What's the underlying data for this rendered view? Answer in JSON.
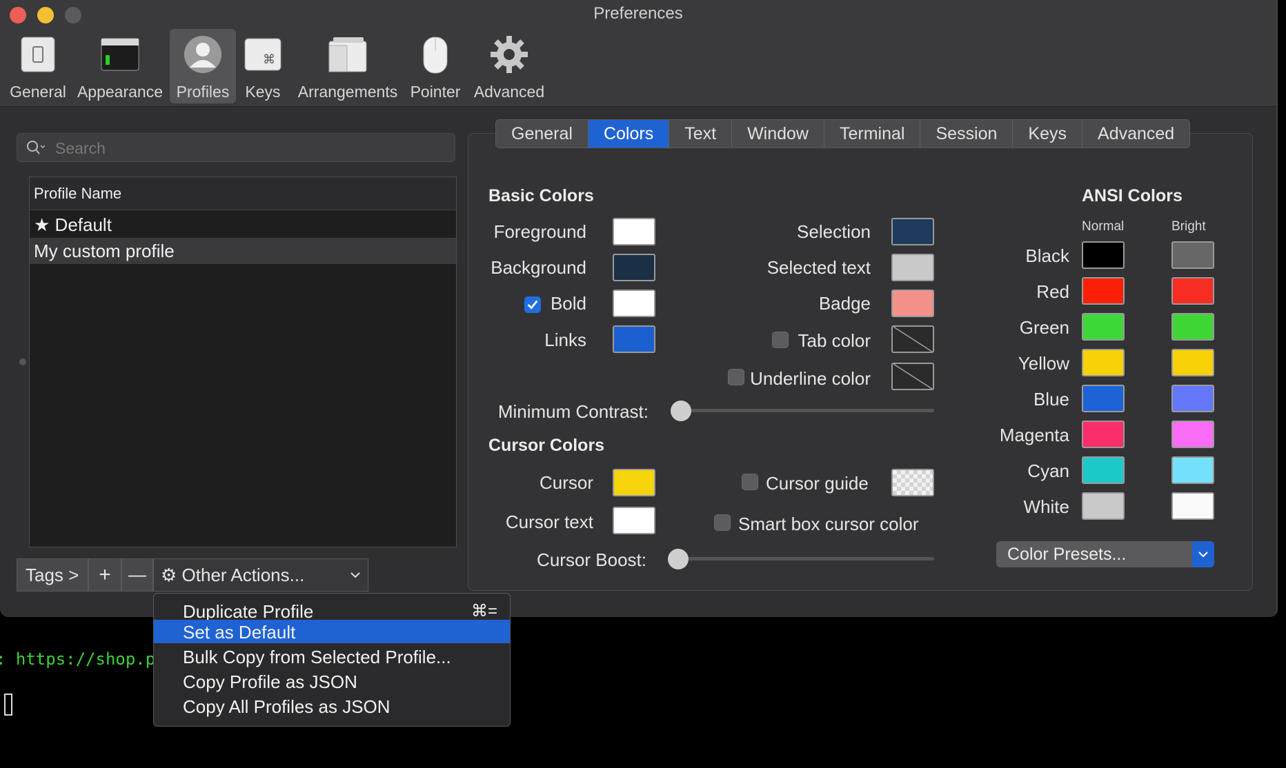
{
  "window": {
    "title": "Preferences"
  },
  "toolbar": [
    {
      "label": "General",
      "icon": "general-icon"
    },
    {
      "label": "Appearance",
      "icon": "appearance-icon"
    },
    {
      "label": "Profiles",
      "icon": "profiles-icon",
      "selected": true
    },
    {
      "label": "Keys",
      "icon": "keys-icon"
    },
    {
      "label": "Arrangements",
      "icon": "arrangements-icon"
    },
    {
      "label": "Pointer",
      "icon": "pointer-icon"
    },
    {
      "label": "Advanced",
      "icon": "gear-icon"
    }
  ],
  "search": {
    "placeholder": "Search"
  },
  "profiles": {
    "header": "Profile Name",
    "rows": [
      {
        "label": "Default",
        "star": true
      },
      {
        "label": "My custom profile",
        "selected": true
      }
    ]
  },
  "bottom_bar": {
    "tags": "Tags >",
    "add": "+",
    "remove": "—",
    "other_actions": "Other Actions..."
  },
  "tabs": [
    {
      "label": "General"
    },
    {
      "label": "Colors",
      "active": true
    },
    {
      "label": "Text"
    },
    {
      "label": "Window"
    },
    {
      "label": "Terminal"
    },
    {
      "label": "Session"
    },
    {
      "label": "Keys"
    },
    {
      "label": "Advanced"
    }
  ],
  "basic": {
    "title": "Basic Colors",
    "foreground": {
      "label": "Foreground",
      "color": "#ffffff"
    },
    "background": {
      "label": "Background",
      "color": "#1b2f45"
    },
    "bold": {
      "label": "Bold",
      "color": "#ffffff",
      "checked": true
    },
    "links": {
      "label": "Links",
      "color": "#1c5fcf"
    },
    "selection": {
      "label": "Selection",
      "color": "#1e3a5c"
    },
    "selected_text": {
      "label": "Selected text",
      "color": "#c9c9c9"
    },
    "badge": {
      "label": "Badge",
      "color": "#f3918a"
    },
    "tab_color": {
      "label": "Tab color",
      "checked": false
    },
    "underline_color": {
      "label": "Underline color",
      "checked": false
    },
    "min_contrast": {
      "label": "Minimum Contrast:",
      "value": 0
    }
  },
  "cursor": {
    "title": "Cursor Colors",
    "cursor": {
      "label": "Cursor",
      "color": "#f6d40c"
    },
    "cursor_text": {
      "label": "Cursor text",
      "color": "#ffffff"
    },
    "cursor_guide": {
      "label": "Cursor guide",
      "checked": false
    },
    "smart_box": {
      "label": "Smart box cursor color",
      "checked": false
    },
    "boost": {
      "label": "Cursor Boost:",
      "value": 0
    }
  },
  "ansi": {
    "title": "ANSI Colors",
    "normal_label": "Normal",
    "bright_label": "Bright",
    "rows": [
      {
        "label": "Black",
        "normal": "#000000",
        "bright": "#676767"
      },
      {
        "label": "Red",
        "normal": "#fb1f08",
        "bright": "#f72c23"
      },
      {
        "label": "Green",
        "normal": "#3fd83a",
        "bright": "#3ed635"
      },
      {
        "label": "Yellow",
        "normal": "#f8d207",
        "bright": "#f8d207"
      },
      {
        "label": "Blue",
        "normal": "#1d62d6",
        "bright": "#6578fa"
      },
      {
        "label": "Magenta",
        "normal": "#fb2d6a",
        "bright": "#fb6cf6"
      },
      {
        "label": "Cyan",
        "normal": "#1bc9c9",
        "bright": "#75e2fb"
      },
      {
        "label": "White",
        "normal": "#c9c9c9",
        "bright": "#fafafa"
      }
    ],
    "presets": "Color Presets..."
  },
  "terminal": {
    "line": ": https://shop.p"
  },
  "menu": {
    "items": [
      {
        "label": "Duplicate Profile",
        "shortcut": "⌘="
      },
      {
        "label": "Set as Default",
        "highlighted": true
      },
      {
        "label": "Bulk Copy from Selected Profile..."
      },
      {
        "label": "Copy Profile as JSON"
      },
      {
        "label": "Copy All Profiles as JSON"
      }
    ]
  }
}
